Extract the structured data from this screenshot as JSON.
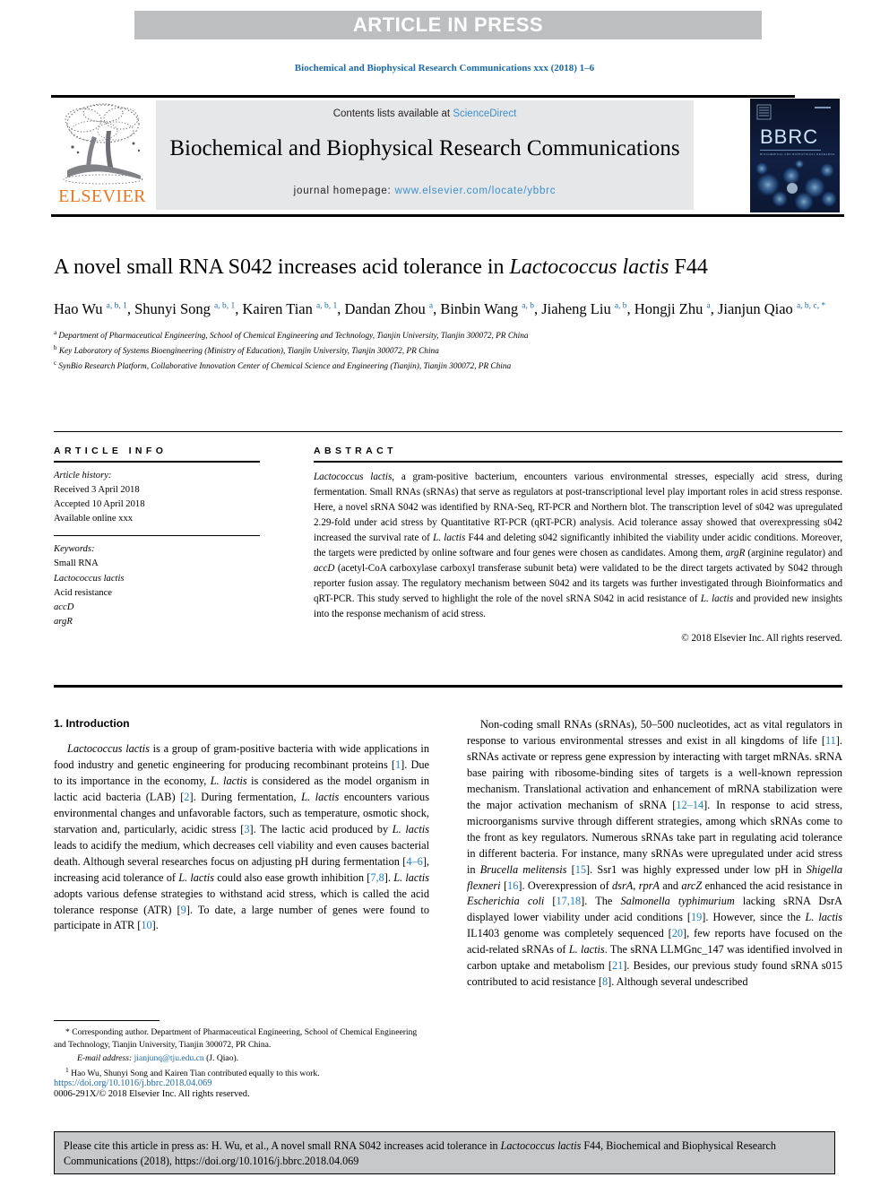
{
  "banner": {
    "label": "ARTICLE IN PRESS"
  },
  "running_head": "Biochemical and Biophysical Research Communications xxx (2018) 1–6",
  "masthead": {
    "contents_prefix": "Contents lists available at ",
    "sciencedirect": "ScienceDirect",
    "journal_name": "Biochemical and Biophysical Research Communications",
    "homepage_prefix": "journal homepage: ",
    "homepage_url": "www.elsevier.com/locate/ybbrc",
    "publisher": "ELSEVIER",
    "cover_label": "BBRC",
    "cover_sub": "BIOCHEMICAL AND BIOPHYSICAL RESEARCH COMMUNICATIONS"
  },
  "title": {
    "part1": "A novel small RNA S042 increases acid tolerance in ",
    "italic": "Lactococcus lactis",
    "part2": " F44"
  },
  "authors": [
    {
      "name": "Hao Wu",
      "sup": "a, b, 1",
      "sep": ", "
    },
    {
      "name": "Shunyi Song",
      "sup": "a, b, 1",
      "sep": ", "
    },
    {
      "name": "Kairen Tian",
      "sup": "a, b, 1",
      "sep": ", "
    },
    {
      "name": "Dandan Zhou",
      "sup": "a",
      "sep": ", "
    },
    {
      "name": "Binbin Wang",
      "sup": "a, b",
      "sep": ", "
    },
    {
      "name": "Jiaheng Liu",
      "sup": "a, b",
      "sep": ", "
    },
    {
      "name": "Hongji Zhu",
      "sup": "a",
      "sep": ", "
    },
    {
      "name": "Jianjun Qiao",
      "sup": "a, b, c, *",
      "sep": ""
    }
  ],
  "affiliations": [
    {
      "marker": "a",
      "text": "Department of Pharmaceutical Engineering, School of Chemical Engineering and Technology, Tianjin University, Tianjin 300072, PR China"
    },
    {
      "marker": "b",
      "text": "Key Laboratory of Systems Bioengineering (Ministry of Education), Tianjin University, Tianjin 300072, PR China"
    },
    {
      "marker": "c",
      "text": "SynBio Research Platform, Collaborative Innovation Center of Chemical Science and Engineering (Tianjin), Tianjin 300072, PR China"
    }
  ],
  "article_info": {
    "heading": "ARTICLE INFO",
    "history_label": "Article history:",
    "received": "Received 3 April 2018",
    "accepted": "Accepted 10 April 2018",
    "available": "Available online xxx",
    "keywords_label": "Keywords:",
    "keywords": [
      {
        "text": "Small RNA",
        "italic": false
      },
      {
        "text": "Lactococcus lactis",
        "italic": true
      },
      {
        "text": "Acid resistance",
        "italic": false
      },
      {
        "text": "accD",
        "italic": true
      },
      {
        "text": "argR",
        "italic": true
      }
    ]
  },
  "abstract": {
    "heading": "ABSTRACT",
    "text_lead_italic": "Lactococcus lactis",
    "text": ", a gram-positive bacterium, encounters various environmental stresses, especially acid stress, during fermentation. Small RNAs (sRNAs) that serve as regulators at post-transcriptional level play important roles in acid stress response. Here, a novel sRNA S042 was identified by RNA-Seq, RT-PCR and Northern blot. The transcription level of s042 was upregulated 2.29-fold under acid stress by Quantitative RT-PCR (qRT-PCR) analysis. Acid tolerance assay showed that overexpressing s042 increased the survival rate of L. lactis F44 and deleting s042 significantly inhibited the viability under acidic conditions. Moreover, the targets were predicted by online software and four genes were chosen as candidates. Among them, argR (arginine regulator) and accD (acetyl-CoA carboxylase carboxyl transferase subunit beta) were validated to be the direct targets activated by S042 through reporter fusion assay. The regulatory mechanism between S042 and its targets was further investigated through Bioinformatics and qRT-PCR. This study served to highlight the role of the novel sRNA S042 in acid resistance of L. lactis and provided new insights into the response mechanism of acid stress.",
    "copyright": "© 2018 Elsevier Inc. All rights reserved."
  },
  "body": {
    "section_number_title": "1.  Introduction",
    "left_paragraph": "Lactococcus lactis is a group of gram-positive bacteria with wide applications in food industry and genetic engineering for producing recombinant proteins [1]. Due to its importance in the economy, L. lactis is considered as the model organism in lactic acid bacteria (LAB) [2]. During fermentation, L. lactis encounters various environmental changes and unfavorable factors, such as temperature, osmotic shock, starvation and, particularly, acidic stress [3]. The lactic acid produced by L. lactis leads to acidify the medium, which decreases cell viability and even causes bacterial death. Although several researches focus on adjusting pH during fermentation [4–6], increasing acid tolerance of L. lactis could also ease growth inhibition [7,8]. L. lactis adopts various defense strategies to withstand acid stress, which is called the acid tolerance response (ATR) [9]. To date, a large number of genes were found to participate in ATR [10].",
    "right_paragraph": "Non-coding small RNAs (sRNAs), 50–500 nucleotides, act as vital regulators in response to various environmental stresses and exist in all kingdoms of life [11]. sRNAs activate or repress gene expression by interacting with target mRNAs. sRNA base pairing with ribosome-binding sites of targets is a well-known repression mechanism. Translational activation and enhancement of mRNA stabilization were the major activation mechanism of sRNA [12–14]. In response to acid stress, microorganisms survive through different strategies, among which sRNAs come to the front as key regulators. Numerous sRNAs take part in regulating acid tolerance in different bacteria. For instance, many sRNAs were upregulated under acid stress in Brucella melitensis [15]. Ssr1 was highly expressed under low pH in Shigella flexneri [16]. Overexpression of dsrA, rprA and arcZ enhanced the acid resistance in Escherichia coli [17,18]. The Salmonella typhimurium lacking sRNA DsrA displayed lower viability under acid conditions [19]. However, since the L. lactis IL1403 genome was completely sequenced [20], few reports have focused on the acid-related sRNAs of L. lactis. The sRNA LLMGnc_147 was identified involved in carbon uptake and metabolism [21]. Besides, our previous study found sRNA s015 contributed to acid resistance [8]. Although several undescribed"
  },
  "footnotes": {
    "corresponding_marker": "*",
    "corresponding": "Corresponding author. Department of Pharmaceutical Engineering, School of Chemical Engineering and Technology, Tianjin University, Tianjin 300072, PR China.",
    "email_label": "E-mail address:",
    "email": "jianjunq@tju.edu.cn",
    "email_suffix": " (J. Qiao).",
    "equal_marker": "1",
    "equal_contrib": "Hao Wu, Shunyi Song and Kairen Tian contributed equally to this work."
  },
  "doi": {
    "url": "https://doi.org/10.1016/j.bbrc.2018.04.069",
    "issn": "0006-291X/© 2018 Elsevier Inc. All rights reserved."
  },
  "cite_box": {
    "prefix": "Please cite this article in press as: H. Wu, et al., A novel small RNA S042 increases acid tolerance in ",
    "italic": "Lactococcus lactis",
    "suffix": " F44, Biochemical and Biophysical Research Communications (2018), https://doi.org/10.1016/j.bbrc.2018.04.069"
  },
  "colors": {
    "link_blue": "#1e6aa8",
    "ref_blue": "#1e7fc1",
    "elsevier_orange": "#e87722",
    "banner_gray": "#bcbec0",
    "band_gray": "#e6e7e8",
    "cite_gray": "#c7c8ca"
  }
}
